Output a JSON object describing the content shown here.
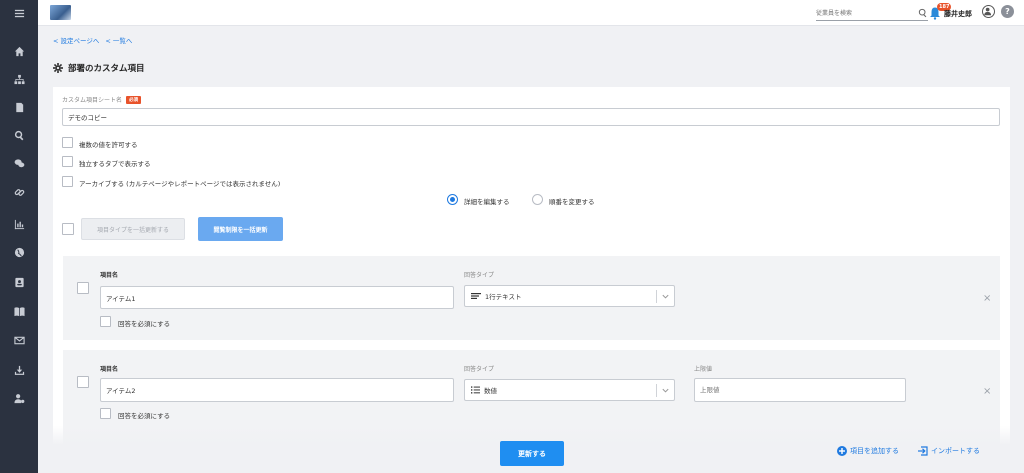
{
  "sidebar": {
    "items": [
      {
        "icon": "menu-icon"
      },
      {
        "icon": "home-icon"
      },
      {
        "icon": "org-chart-icon"
      },
      {
        "icon": "document-icon"
      },
      {
        "icon": "search-icon"
      },
      {
        "icon": "chat-icon"
      },
      {
        "icon": "link-icon"
      },
      {
        "icon": "chart-icon"
      },
      {
        "icon": "globe-icon"
      },
      {
        "icon": "contact-card-icon"
      },
      {
        "icon": "book-icon"
      },
      {
        "icon": "mail-icon"
      },
      {
        "icon": "download-icon"
      },
      {
        "icon": "user-settings-icon"
      }
    ]
  },
  "header": {
    "search_placeholder": "従業員を検索",
    "notification_count": "187",
    "user_name": "藤井史郎",
    "help_label": "?"
  },
  "breadcrumb": {
    "settings": "< 設定ページへ",
    "list": "< 一覧へ"
  },
  "page_title": "部署のカスタム項目",
  "form": {
    "sheet_name_label": "カスタム項目シート名",
    "required_badge": "必須",
    "sheet_name_value": "デモのコピー",
    "option_multiple": "複数の値を許可する",
    "option_separate_tab": "独立するタブで表示する",
    "option_archive": "アーカイブする (カルテページやレポートページでは表示されません)",
    "mode_edit": "詳細を編集する",
    "mode_order": "順番を変更する",
    "bulk_type_button": "項目タイプを一括更新する",
    "bulk_permission_button": "閲覧制限を一括更新"
  },
  "items": [
    {
      "name_label": "項目名",
      "name_value": "アイテム1",
      "type_label": "回答タイプ",
      "type_value": "1行テキスト",
      "required_label": "回答を必須にする"
    },
    {
      "name_label": "項目名",
      "name_value": "アイテム2",
      "type_label": "回答タイプ",
      "type_value": "数値",
      "upper_label": "上限値",
      "upper_placeholder": "上限値",
      "required_label": "回答を必須にする"
    }
  ],
  "footer": {
    "update_button": "更新する",
    "add_item": "項目を追加する",
    "import": "インポートする"
  },
  "colors": {
    "sidebar_bg": "#2b3240",
    "accent": "#1f7ae0",
    "required_badge": "#e8532b",
    "primary_button": "#1f8ef1"
  }
}
